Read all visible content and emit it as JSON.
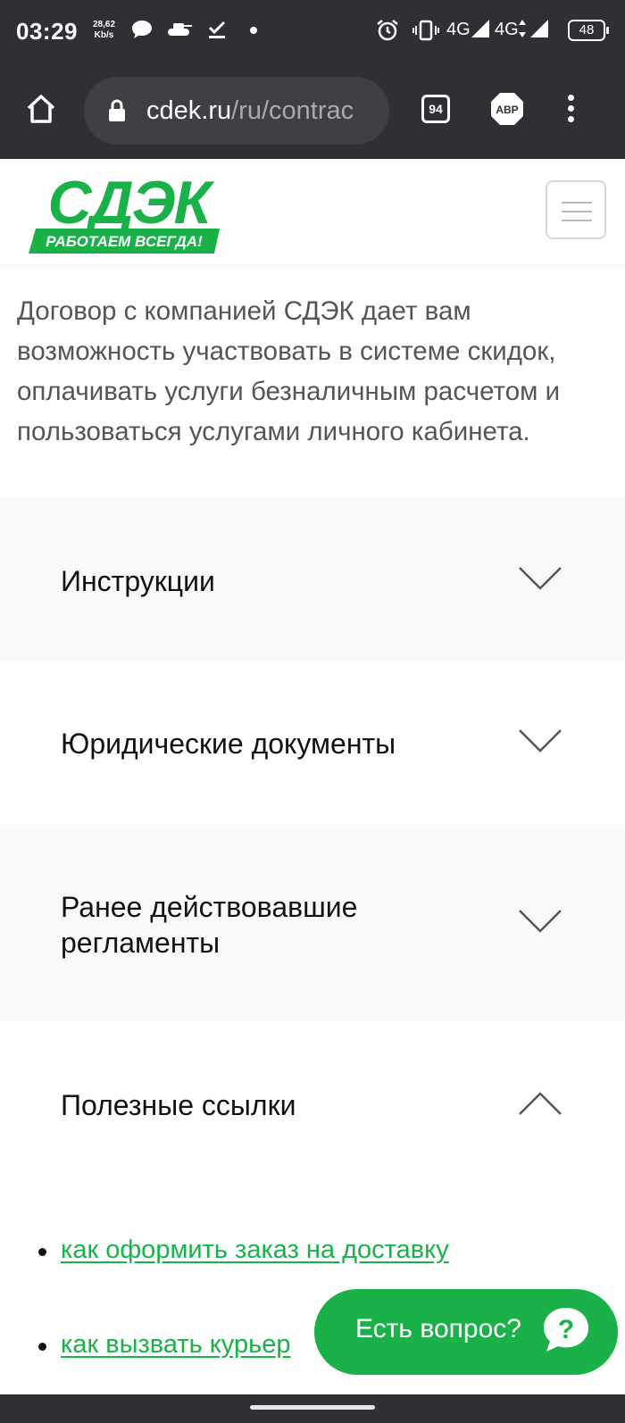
{
  "status_bar": {
    "time": "03:29",
    "speed_value": "28,62",
    "speed_unit": "Kb/s",
    "net1": "4G",
    "net2": "4G",
    "battery": "48"
  },
  "browser": {
    "url_host": "cdek.ru",
    "url_path": "/ru/contrac",
    "tab_count": "94",
    "abp_label": "ABP"
  },
  "header": {
    "logo_text": "СДЭК",
    "logo_tagline": "РАБОТАЕМ ВСЕГДА!",
    "brand_color": "#1ab248"
  },
  "intro_text": "Договор с компанией СДЭК дает вам возможность участвовать в системе скидок, оплачивать услуги безналичным расчетом и пользоваться услугами личного кабинета.",
  "accordion": [
    {
      "title": "Инструкции",
      "expanded": false
    },
    {
      "title": "Юридические документы",
      "expanded": false
    },
    {
      "title": "Ранее действовавшие регламенты",
      "expanded": false
    },
    {
      "title": "Полезные ссылки",
      "expanded": true
    }
  ],
  "useful_links": [
    "как оформить заказ на доставку",
    "как вызвать курьер"
  ],
  "fab": {
    "label": "Есть вопрос?",
    "icon": "question-icon"
  }
}
